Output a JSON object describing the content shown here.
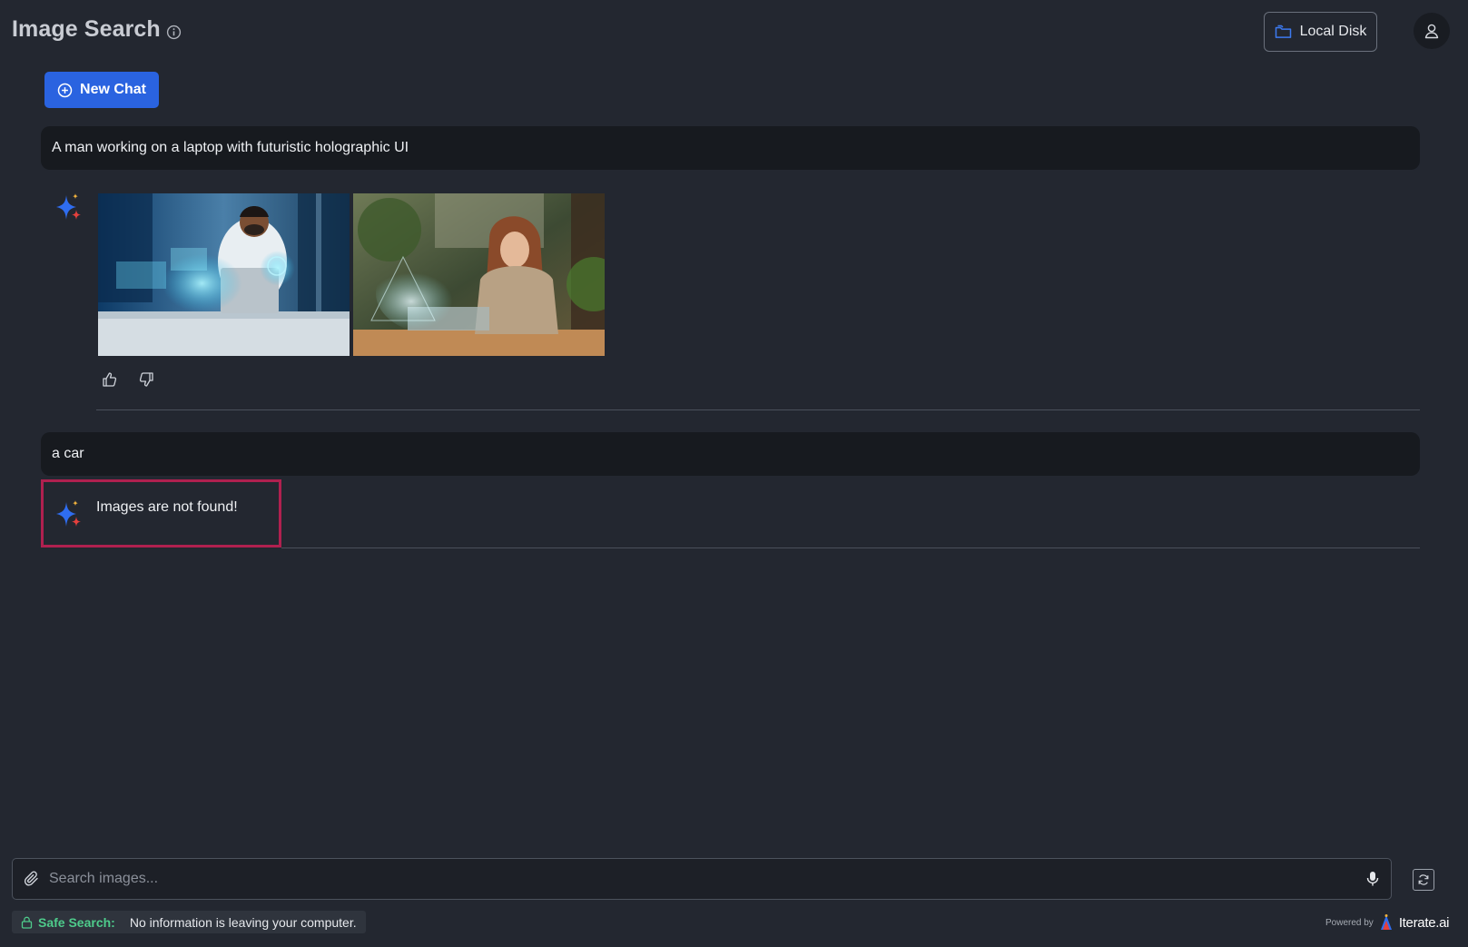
{
  "header": {
    "title": "Image Search",
    "local_disk_label": "Local Disk"
  },
  "toolbar": {
    "new_chat_label": "New Chat"
  },
  "conversation": [
    {
      "query": "A man working on a laptop with futuristic holographic UI",
      "results": [
        {
          "description": "man with glasses at laptop with holographic interface"
        },
        {
          "description": "woman at laptop outdoors with holographic effects"
        }
      ]
    },
    {
      "query": "a car",
      "response_text": "Images are not found!"
    }
  ],
  "search": {
    "placeholder": "Search images..."
  },
  "footer": {
    "safe_search_label": "Safe Search:",
    "safe_search_message": "No information is leaving your computer.",
    "powered_by_label": "Powered by",
    "brand_name": "Iterate.ai"
  },
  "colors": {
    "background": "#232730",
    "accent": "#2a63e0",
    "highlight_border": "#b0204f",
    "safe_green": "#4ecb8b"
  }
}
